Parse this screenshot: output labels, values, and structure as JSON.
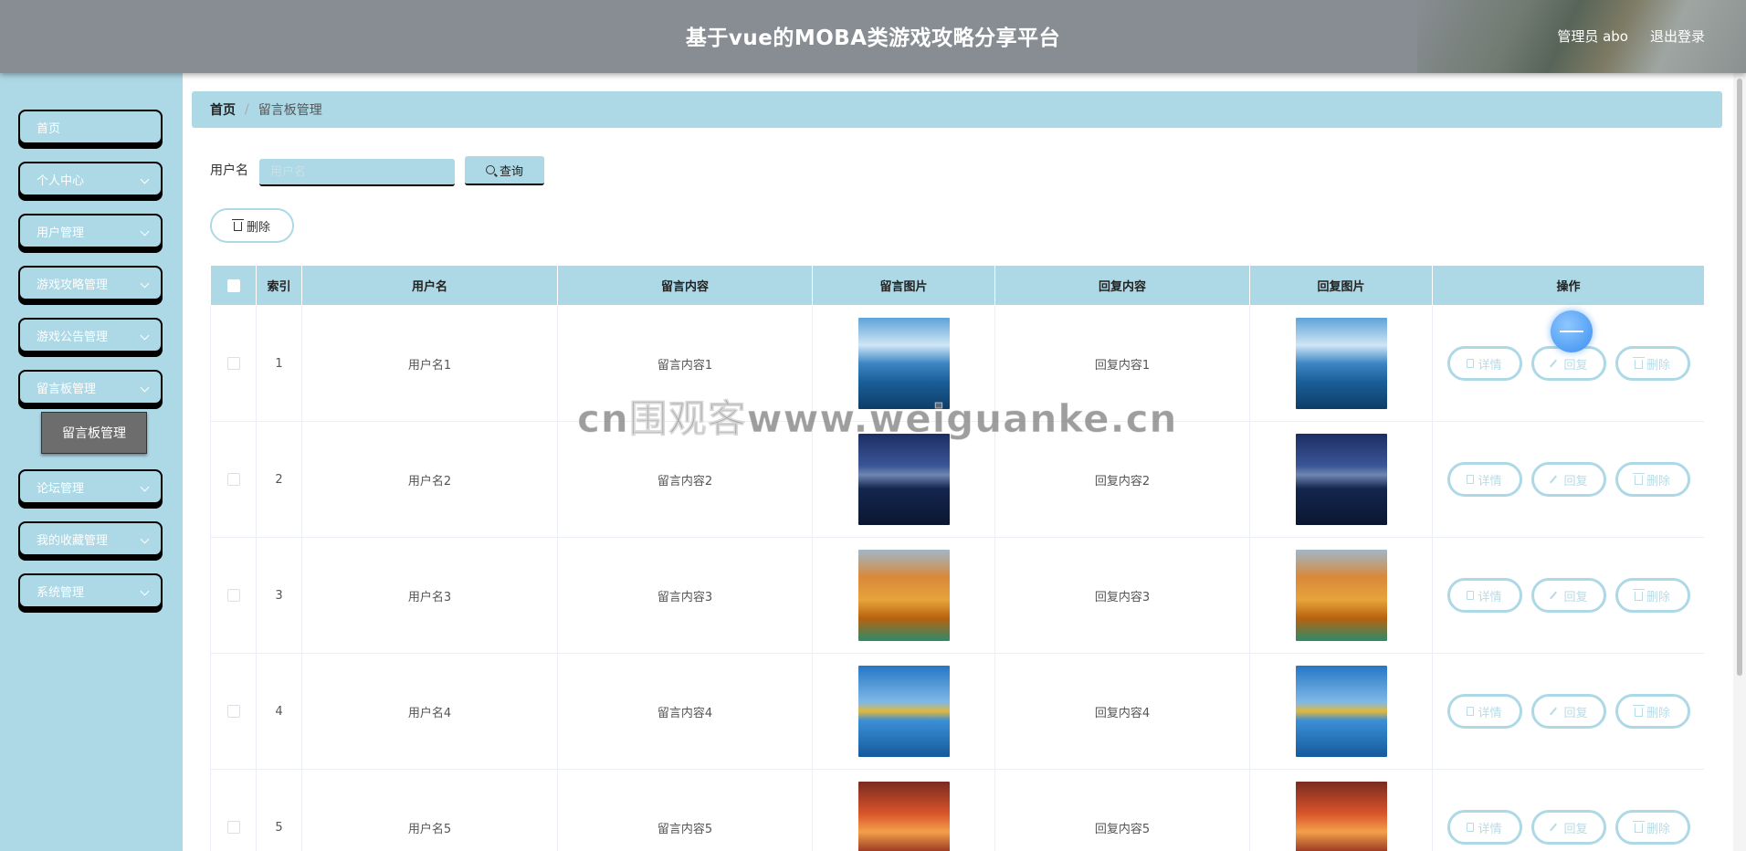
{
  "header": {
    "title": "基于vue的MOBA类游戏攻略分享平台",
    "user": "管理员 abo",
    "logout": "退出登录"
  },
  "sidebar": {
    "items": [
      {
        "label": "首页",
        "has_arrow": false
      },
      {
        "label": "个人中心",
        "has_arrow": true
      },
      {
        "label": "用户管理",
        "has_arrow": true
      },
      {
        "label": "游戏攻略管理",
        "has_arrow": true
      },
      {
        "label": "游戏公告管理",
        "has_arrow": true
      },
      {
        "label": "留言板管理",
        "has_arrow": true
      },
      {
        "label": "论坛管理",
        "has_arrow": true
      },
      {
        "label": "我的收藏管理",
        "has_arrow": true
      },
      {
        "label": "系统管理",
        "has_arrow": true
      }
    ],
    "submenu": {
      "label": "留言板管理"
    }
  },
  "breadcrumb": {
    "home": "首页",
    "separator": "/",
    "current": "留言板管理"
  },
  "search": {
    "label": "用户名",
    "placeholder": "用户名",
    "button": "查询"
  },
  "toolbar": {
    "delete": "删除"
  },
  "table": {
    "headers": [
      "索引",
      "用户名",
      "留言内容",
      "留言图片",
      "回复内容",
      "回复图片",
      "操作"
    ],
    "rows": [
      {
        "index": "1",
        "username": "用户名1",
        "content": "留言内容1",
        "reply": "回复内容1",
        "image": "lake-clouds"
      },
      {
        "index": "2",
        "username": "用户名2",
        "content": "留言内容2",
        "reply": "回复内容2",
        "image": "night-lake"
      },
      {
        "index": "3",
        "username": "用户名3",
        "content": "留言内容3",
        "reply": "回复内容3",
        "image": "autumn-bridge"
      },
      {
        "index": "4",
        "username": "用户名4",
        "content": "留言内容4",
        "reply": "回复内容4",
        "image": "tree-lake"
      },
      {
        "index": "5",
        "username": "用户名5",
        "content": "留言内容5",
        "reply": "回复内容5",
        "image": "sunset"
      }
    ],
    "actions": {
      "detail": "详情",
      "reply": "回复",
      "delete": "删除"
    }
  },
  "watermark": "cn围观客www.weiguanke.cn",
  "colors": {
    "accent": "#add8e6",
    "header": "#878d92",
    "submenu": "#6d6d6d"
  }
}
